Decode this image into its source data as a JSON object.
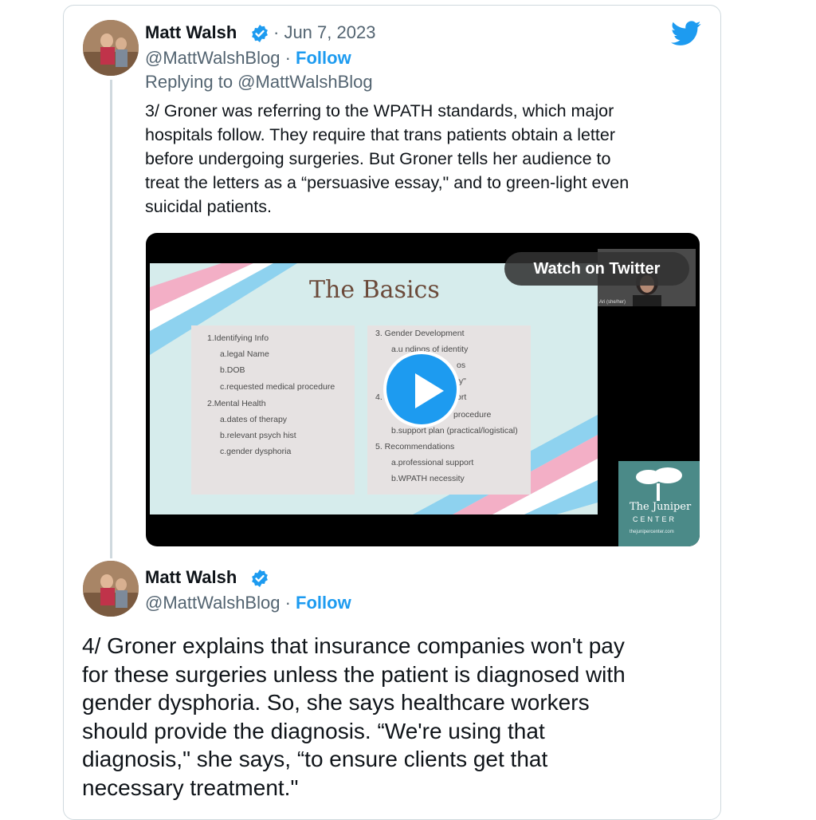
{
  "tweet1": {
    "name": "Matt Walsh",
    "date": "· Jun 7, 2023",
    "handle": "@MattWalshBlog ·",
    "follow": "Follow",
    "reply": "Replying to @MattWalshBlog",
    "text_lines": [
      "3/ Groner was referring to the WPATH standards, which major",
      "hospitals follow. They require that trans patients obtain a letter",
      "before undergoing surgeries. But Groner tells her audience to",
      "treat the letters as a “persuasive essay,\" and to green-light even",
      "suicidal patients."
    ]
  },
  "video": {
    "watch_label": "Watch on Twitter",
    "slide_title": "The Basics",
    "left_box": [
      "1.Identifying Info",
      "a.legal Name",
      "b.DOB",
      "c.requested medical procedure",
      "2.Mental Health",
      "a.dates of therapy",
      "b.relevant psych hist",
      "c.gender dysphoria"
    ],
    "right_box": [
      "3. Gender Development",
      "a.u            ndings of identity",
      "os",
      "ty\"",
      "4. L",
      "ort",
      "procedure",
      "b.support plan (practical/logistical)",
      "5. Recommendations",
      "a.professional support",
      "b.WPATH necessity"
    ],
    "cam_label": "Ari (she/her)",
    "juniper_name": "The Juniper",
    "juniper_center": "CENTER",
    "juniper_url": "thejunipercenter.com"
  },
  "tweet2": {
    "name": "Matt Walsh",
    "handle": "@MattWalshBlog ·",
    "follow": "Follow",
    "text_lines": [
      "4/ Groner explains that insurance companies won't pay",
      "for these surgeries unless the patient is diagnosed with",
      "gender dysphoria. So, she says healthcare workers",
      "should provide the diagnosis. “We're using that",
      "diagnosis,\" she says, “to ensure clients get that",
      "necessary treatment.\""
    ]
  },
  "colors": {
    "accent": "#1d9bf0",
    "muted": "#536471",
    "text": "#0f1419"
  },
  "icons": {
    "verified": "verified-badge-icon",
    "logo": "twitter-bird-icon",
    "play": "play-icon"
  }
}
